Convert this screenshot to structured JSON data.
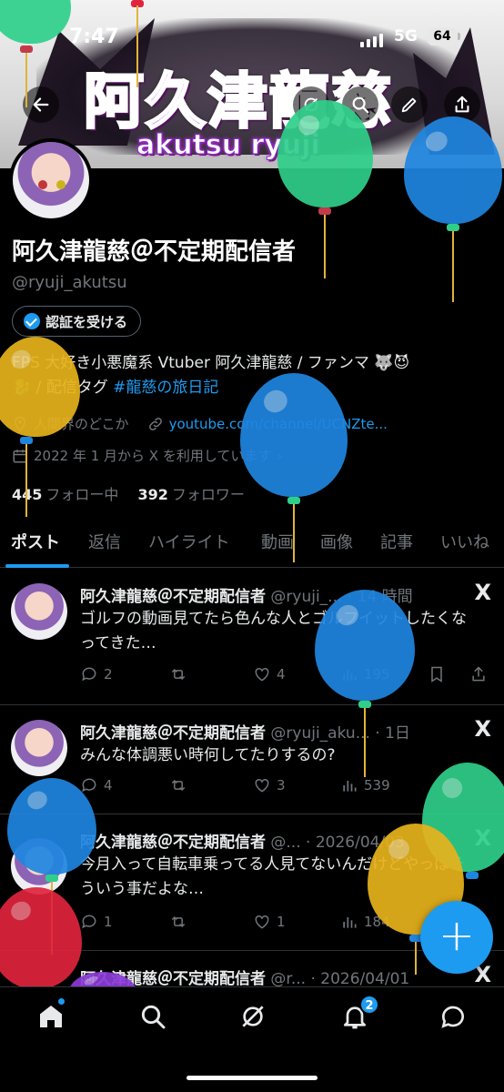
{
  "status_bar": {
    "time": "7:47",
    "network": "5G",
    "battery": "64"
  },
  "banner": {
    "title": "阿久津龍慈",
    "subtitle": "akutsu ryuji"
  },
  "profile": {
    "name": "阿久津龍慈＠不定期配信者",
    "handle": "@ryuji_akutsu",
    "verify_label": "認証を受ける",
    "bio_line1": "FPS 大好き小悪魔系 Vtuber 阿久津龍慈 / ファンマ 🐺😈",
    "bio_line2_prefix": "🐉 / 配信タグ ",
    "bio_hashtag": "#龍慈の旅日記",
    "location": "人間界のどこか",
    "link": "youtube.com/channel/UCNZte...",
    "joined": "2022 年 1 月から X を利用しています",
    "following_count": "445",
    "following_label": "フォロー中",
    "followers_count": "392",
    "followers_label": "フォロワー"
  },
  "tabs": [
    "ポスト",
    "返信",
    "ハイライト",
    "動画",
    "画像",
    "記事",
    "いいね"
  ],
  "posts": [
    {
      "name": "阿久津龍慈＠不定期配信者",
      "meta": "@ryuji_... · 14 時間",
      "text": "ゴルフの動画見てたら色んな人とゴルフイットしたくなってきた…",
      "replies": "2",
      "reposts": "",
      "likes": "4",
      "views": "195"
    },
    {
      "name": "阿久津龍慈＠不定期配信者",
      "meta": "@ryuji_aku... · 1日",
      "text": "みんな体調悪い時何してたりするの?",
      "replies": "4",
      "reposts": "",
      "likes": "3",
      "views": "539"
    },
    {
      "name": "阿久津龍慈＠不定期配信者",
      "meta": "@... · 2026/04/03",
      "text": "今月入って自転車乗ってる人見てないんだけどやっぱそういう事だよな…",
      "replies": "1",
      "reposts": "",
      "likes": "1",
      "views": "184"
    },
    {
      "name": "阿久津龍慈＠不定期配信者",
      "meta": "@r... · 2026/04/01",
      "text": "",
      "replies": "",
      "reposts": "",
      "likes": "",
      "views": ""
    }
  ],
  "nav": {
    "notification_badge": "2"
  },
  "fab_label": "+",
  "x_logo": "X",
  "colors": {
    "accent": "#1d9bf0",
    "background": "#000000",
    "muted": "#71767b"
  },
  "balloon_colors": [
    "#2fcf8a",
    "#1f86e0",
    "#e7b21c",
    "#e0243d",
    "#8a3bd6"
  ]
}
